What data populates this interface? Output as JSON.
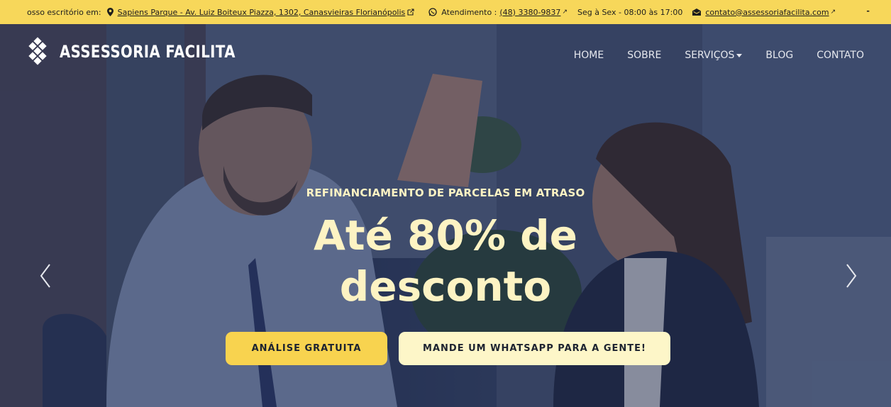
{
  "topbar": {
    "office_label": "osso escritório em:",
    "address": "Sapiens Parque - Av. Luiz Boiteux Piazza, 1302, Canasvieiras Florianópolis",
    "atendimento_label": "Atendimento :",
    "phone": "(48) 3380-9837",
    "hours": "Seg à Sex - 08:00 às 17:00",
    "email": "contato@assessoriafacilita.com",
    "ext_arrow": "↗",
    "trailing": "-"
  },
  "nav": {
    "brand": "ASSESSORIA FACILITA",
    "items": [
      {
        "label": "HOME"
      },
      {
        "label": "SOBRE"
      },
      {
        "label": "SERVIÇOS"
      },
      {
        "label": "BLOG"
      },
      {
        "label": "CONTATO"
      }
    ]
  },
  "hero": {
    "eyebrow": "REFINANCIAMENTO DE PARCELAS EM ATRASO",
    "headline_line1": "Até 80% de",
    "headline_line2": "desconto",
    "primary_button": "ANÁLISE GRATUITA",
    "secondary_button": "MANDE UM WHATSAPP PARA A GENTE!"
  },
  "icons": [
    "map-pin-icon",
    "external-link-icon",
    "whatsapp-icon",
    "envelope-icon",
    "logo-mark-icon",
    "chevron-down-icon",
    "chevron-left-icon",
    "chevron-right-icon"
  ],
  "colors": {
    "topbar_bg": "#f7d75a",
    "accent_yellow": "#f8d34f",
    "cream": "#fdf6c8",
    "headline_text": "#fdf3c3",
    "hero_overlay": "#1a2446"
  }
}
